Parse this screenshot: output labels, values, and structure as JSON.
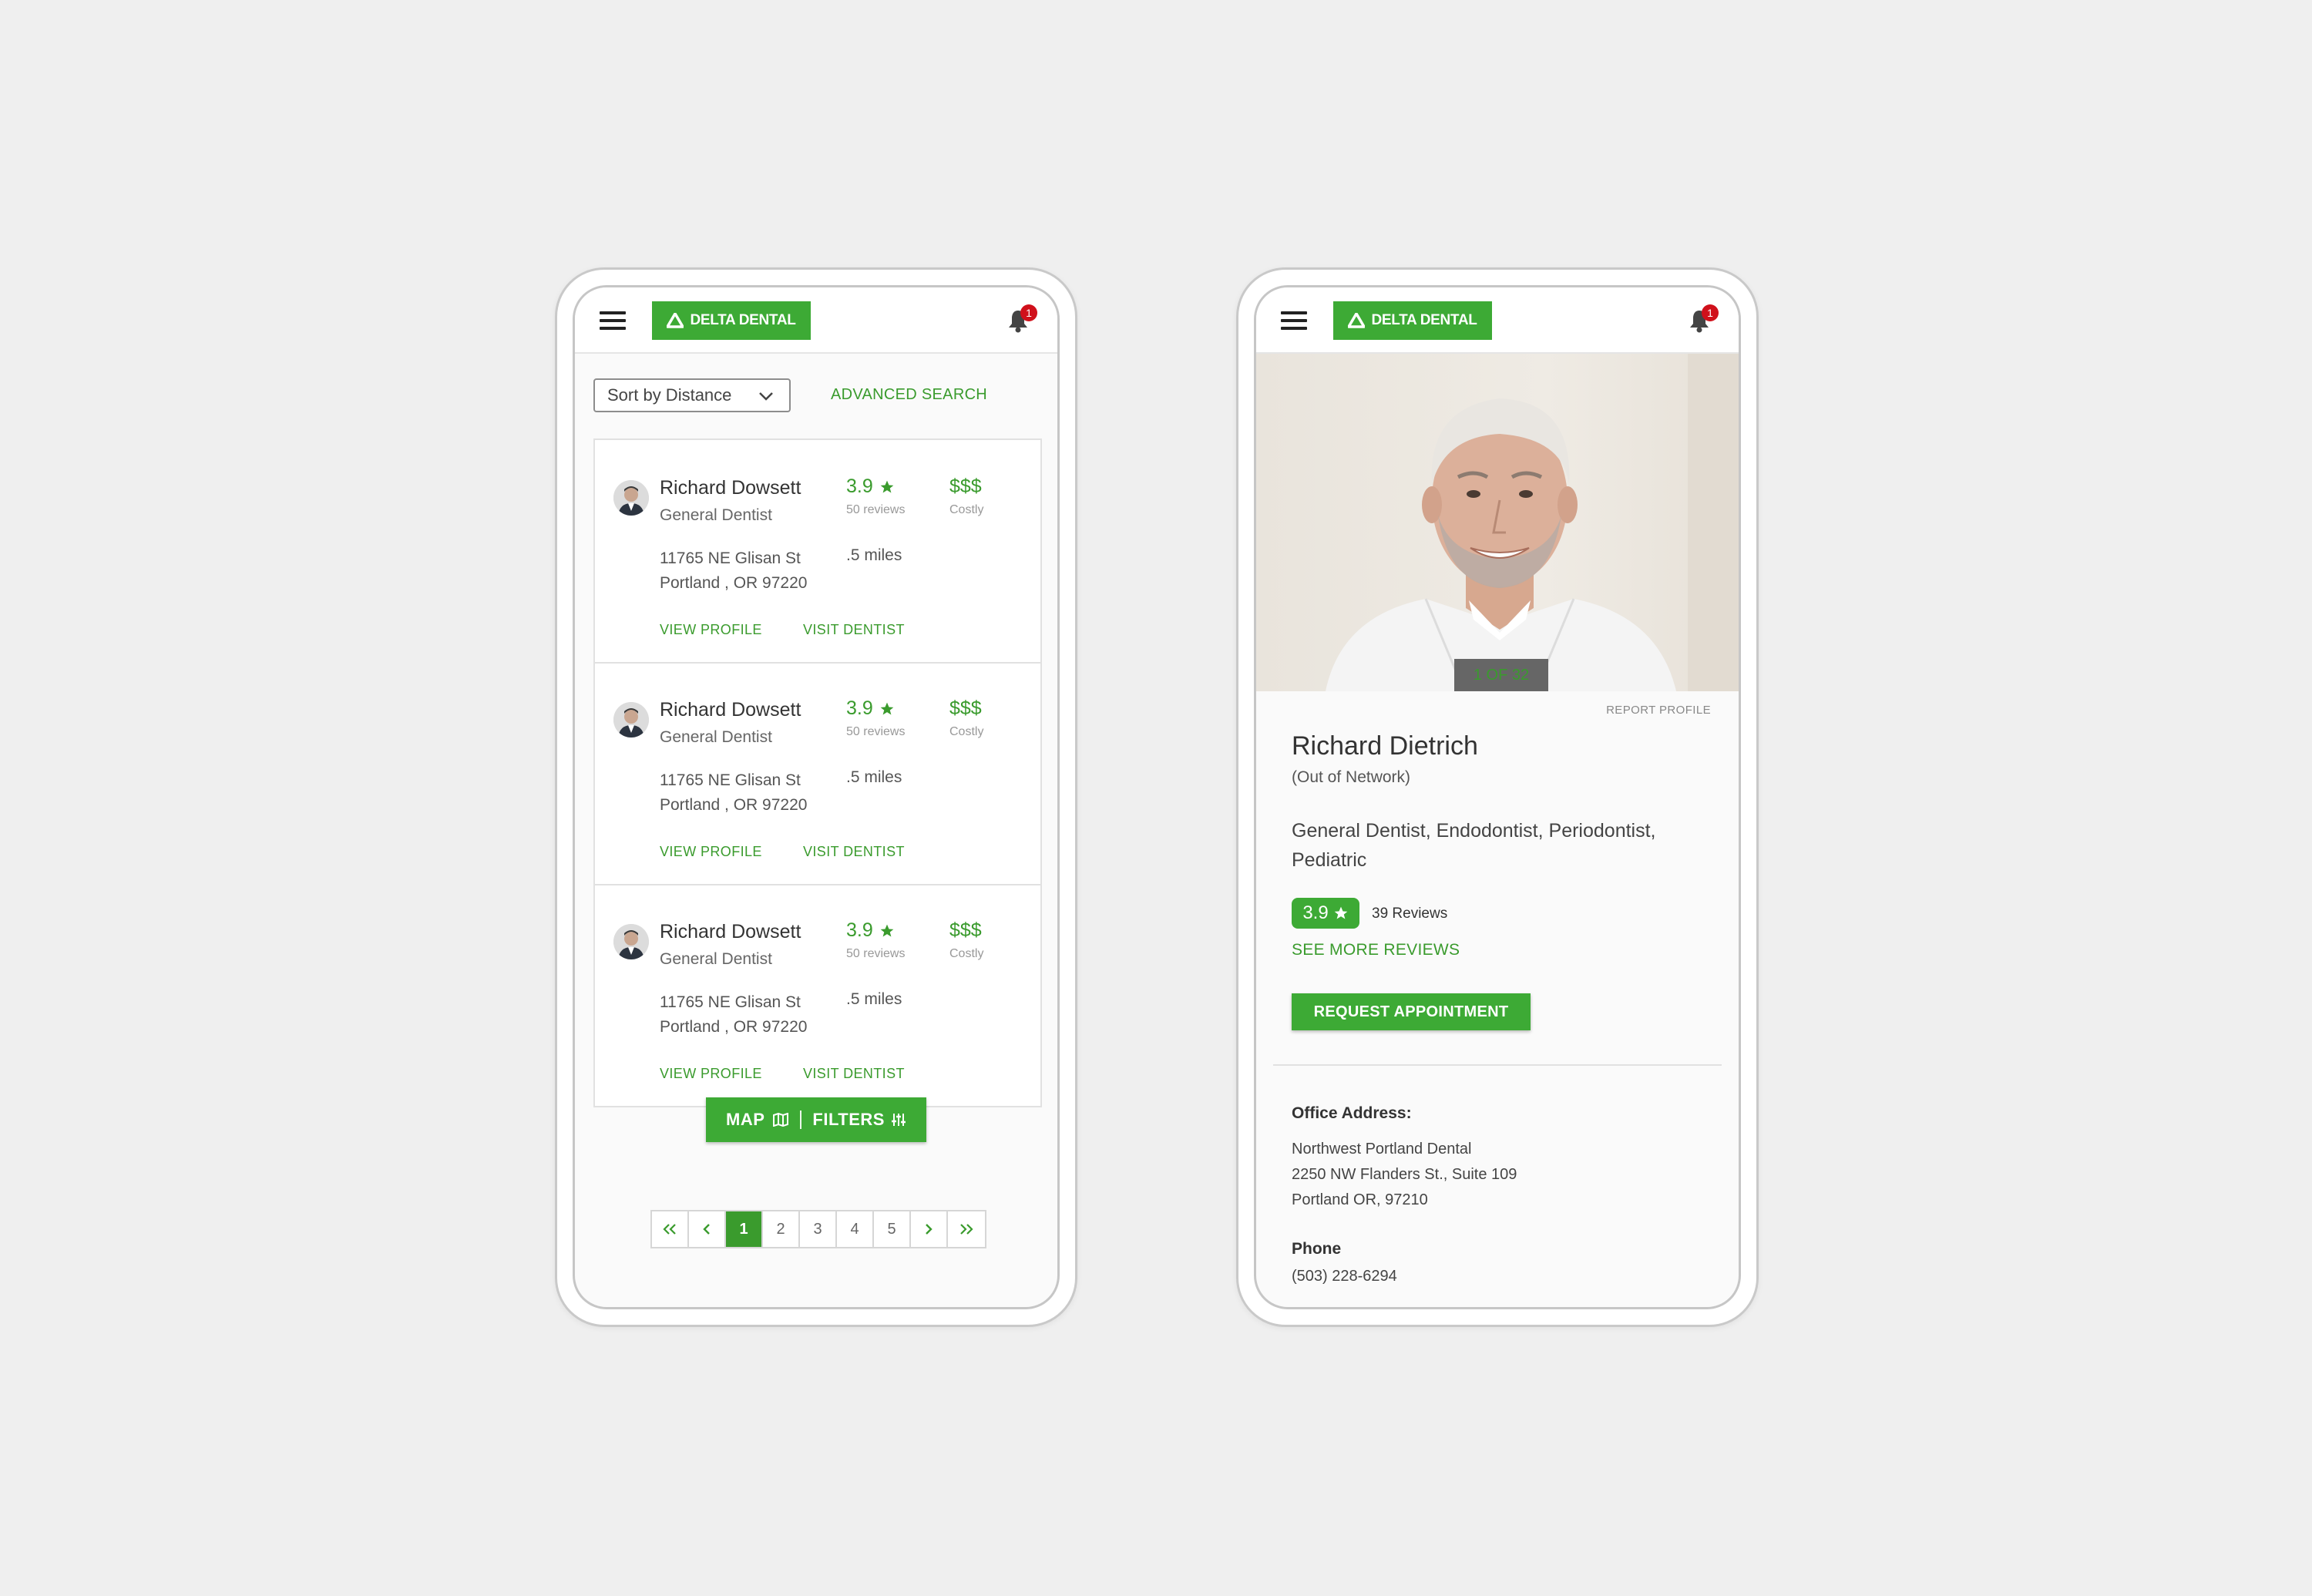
{
  "brand": {
    "name": "DELTA DENTAL",
    "color": "#3daa35",
    "notification_count": "1"
  },
  "search": {
    "sort_label": "Sort by Distance",
    "advanced_search": "ADVANCED SEARCH",
    "results": [
      {
        "name": "Richard Dowsett",
        "specialty": "General Dentist",
        "rating": "3.9",
        "reviews": "50 reviews",
        "cost": "$$$",
        "cost_label": "Costly",
        "address_line1": "11765 NE Glisan St",
        "address_line2": "Portland , OR 97220",
        "distance": ".5 miles",
        "view_profile": "VIEW PROFILE",
        "visit_dentist": "VISIT DENTIST"
      },
      {
        "name": "Richard Dowsett",
        "specialty": "General Dentist",
        "rating": "3.9",
        "reviews": "50 reviews",
        "cost": "$$$",
        "cost_label": "Costly",
        "address_line1": "11765 NE Glisan St",
        "address_line2": "Portland , OR 97220",
        "distance": ".5 miles",
        "view_profile": "VIEW PROFILE",
        "visit_dentist": "VISIT DENTIST"
      },
      {
        "name": "Richard Dowsett",
        "specialty": "General Dentist",
        "rating": "3.9",
        "reviews": "50 reviews",
        "cost": "$$$",
        "cost_label": "Costly",
        "address_line1": "11765 NE Glisan St",
        "address_line2": "Portland , OR 97220",
        "distance": ".5 miles",
        "view_profile": "VIEW PROFILE",
        "visit_dentist": "VISIT DENTIST"
      }
    ],
    "map_label": "MAP",
    "filters_label": "FILTERS",
    "pagination": {
      "pages": [
        "1",
        "2",
        "3",
        "4",
        "5"
      ],
      "active": "1"
    }
  },
  "profile": {
    "photo_counter": "1 OF 32",
    "report": "REPORT PROFILE",
    "name": "Richard Dietrich",
    "network": "(Out of Network)",
    "specialties": "General Dentist, Endodontist, Periodontist, Pediatric",
    "rating": "3.9",
    "reviews": "39 Reviews",
    "see_more": "SEE MORE REVIEWS",
    "request": "REQUEST APPOINTMENT",
    "office_label": "Office Address:",
    "office_name": "Northwest Portland Dental",
    "office_street": "2250 NW Flanders St., Suite 109",
    "office_city": "Portland OR, 97210",
    "phone_label": "Phone",
    "phone": "(503) 228-6294"
  }
}
